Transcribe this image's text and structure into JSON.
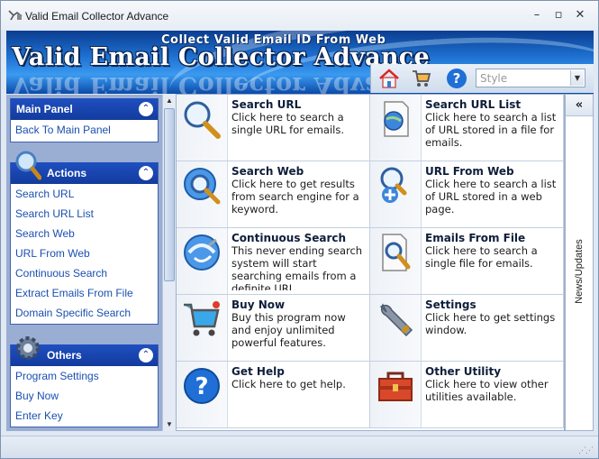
{
  "window": {
    "title": "Valid Email Collector Advance"
  },
  "banner": {
    "subtitle": "Collect Valid Email ID From Web",
    "title": "Valid Email Collector Advance",
    "style_placeholder": "Style"
  },
  "sidebar": {
    "main_panel": {
      "title": "Main Panel",
      "items": [
        "Back To Main Panel"
      ]
    },
    "actions": {
      "title": "Actions",
      "items": [
        "Search URL",
        "Search URL List",
        "Search Web",
        "URL From Web",
        "Continuous Search",
        "Extract Emails From File",
        "Domain Specific Search"
      ]
    },
    "others": {
      "title": "Others",
      "items": [
        "Program Settings",
        "Buy Now",
        "Enter Key"
      ]
    }
  },
  "tiles": [
    {
      "title": "Search URL",
      "desc": "Click here to search a single URL for emails.",
      "icon": "magnifier-icon"
    },
    {
      "title": "Search URL List",
      "desc": "Click here to search a list of URL stored in a file for emails.",
      "icon": "url-list-icon"
    },
    {
      "title": "Search Web",
      "desc": "Click here to get results from search engine for a keyword.",
      "icon": "search-web-icon"
    },
    {
      "title": "URL From Web",
      "desc": "Click here to search a list of URL stored in a web page.",
      "icon": "url-from-web-icon"
    },
    {
      "title": "Continuous Search",
      "desc": "This never ending search system will start searching emails from a definite URL.",
      "icon": "continuous-search-icon"
    },
    {
      "title": "Emails From File",
      "desc": "Click here to search a single file for emails.",
      "icon": "file-search-icon"
    },
    {
      "title": "Buy Now",
      "desc": "Buy this program now and enjoy unlimited powerful features.",
      "icon": "cart-icon"
    },
    {
      "title": "Settings",
      "desc": "Click here to get settings window.",
      "icon": "wrench-icon"
    },
    {
      "title": "Get Help",
      "desc": "Click here to get help.",
      "icon": "help-icon"
    },
    {
      "title": "Other Utility",
      "desc": "Click here to view other utilities available.",
      "icon": "toolbox-icon"
    }
  ],
  "news": {
    "label": "News/Updates",
    "collapse": "«"
  }
}
